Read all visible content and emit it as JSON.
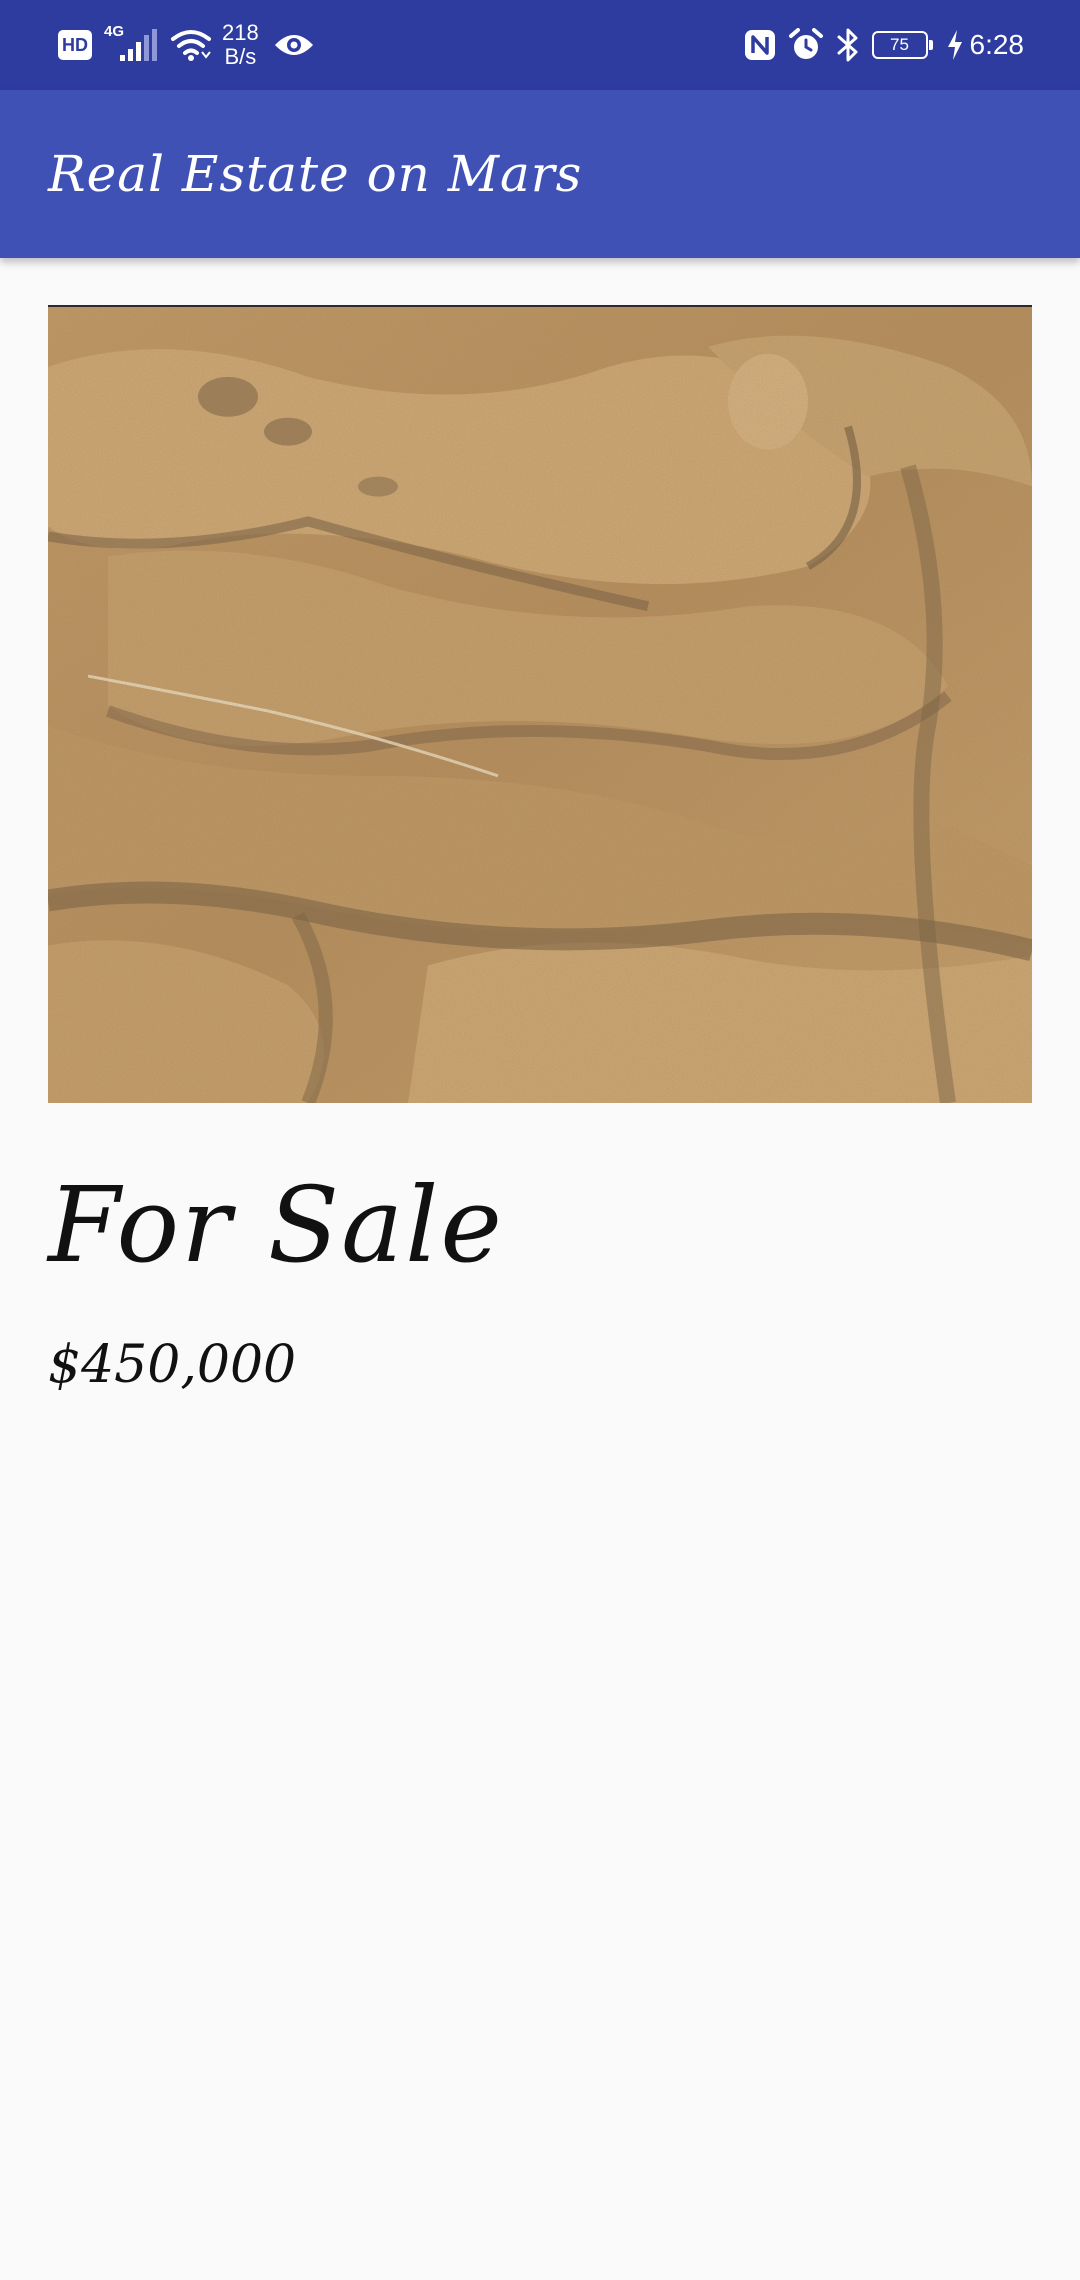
{
  "status_bar": {
    "hd_badge": "HD",
    "network_type": "4G",
    "speed_value": "218",
    "speed_unit": "B/s",
    "battery_level": "75",
    "time": "6:28",
    "icons": [
      "hd-icon",
      "signal-icon",
      "wifi-icon",
      "eye-icon",
      "nfc-icon",
      "alarm-icon",
      "bluetooth-icon",
      "battery-icon",
      "charging-icon"
    ]
  },
  "app_bar": {
    "title": "Real Estate on Mars",
    "color": "#3f51b5"
  },
  "listing": {
    "image_icon": "mars-terrain-photo",
    "status": "For Sale",
    "price": "$450,000"
  },
  "colors": {
    "status_bar": "#2f3c9f",
    "primary": "#3f51b5",
    "background": "#fafafa"
  }
}
